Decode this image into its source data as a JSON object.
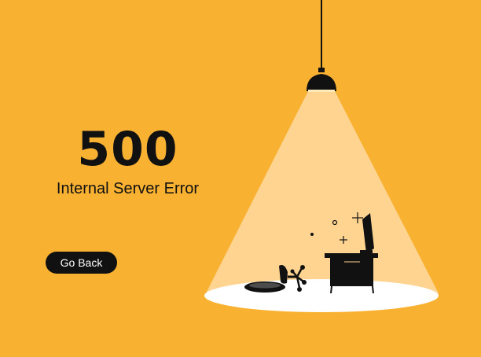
{
  "error": {
    "code": "500",
    "message": "Internal Server Error"
  },
  "actions": {
    "go_back_label": "Go Back"
  },
  "colors": {
    "background": "#F9B131",
    "light_beam": "#FFD491",
    "floor_spot": "#FFFFFF",
    "ink": "#111111",
    "button_text": "#FFFFFF"
  },
  "illustration": {
    "icons": [
      "ceiling-lamp-icon",
      "fallen-chair-icon",
      "desk-icon",
      "computer-monitor-icon",
      "sparkle-icon"
    ]
  }
}
